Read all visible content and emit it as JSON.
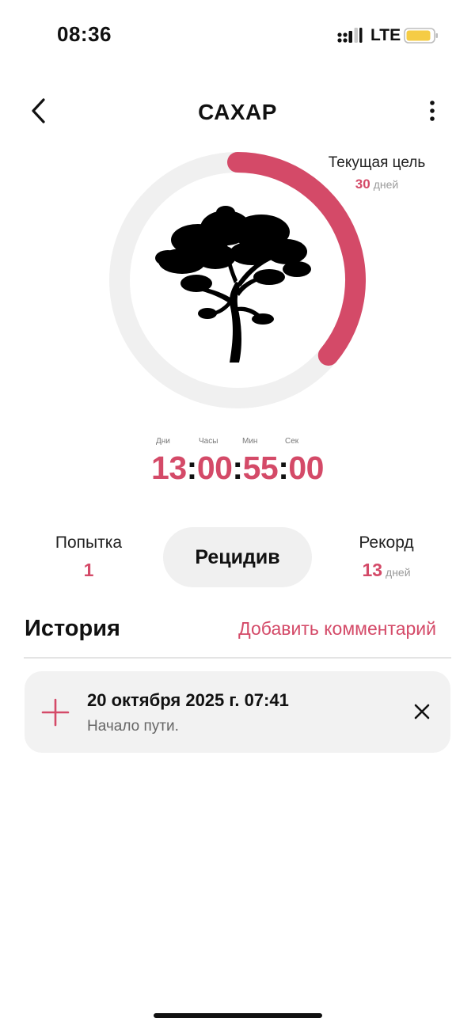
{
  "status_bar": {
    "time": "08:36",
    "network": "LTE"
  },
  "header": {
    "title": "САХАР",
    "back_icon": "chevron-left-icon",
    "more_icon": "more-vertical-icon"
  },
  "goal": {
    "label": "Текущая цель",
    "value": "30",
    "unit": "дней",
    "progress_fraction": 0.36
  },
  "timer": {
    "labels": {
      "days": "Дни",
      "hours": "Часы",
      "minutes": "Мин",
      "seconds": "Сек"
    },
    "days": "13",
    "hours": "00",
    "minutes": "55",
    "seconds": "00",
    "separator": ":"
  },
  "stats": {
    "attempt_label": "Попытка",
    "attempt_value": "1",
    "relapse_button": "Рецидив",
    "record_label": "Рекорд",
    "record_value": "13",
    "record_unit": "дней"
  },
  "history": {
    "title": "История",
    "add_comment": "Добавить комментарий",
    "entries": [
      {
        "date": "20 октября 2025 г. 07:41",
        "note": "Начало пути.",
        "icon": "plus-icon",
        "close_icon": "close-icon"
      }
    ]
  },
  "colors": {
    "accent": "#d44a68",
    "ring_track": "#f0f0f0",
    "card_bg": "#f2f2f2",
    "battery": "#f5cc45"
  }
}
